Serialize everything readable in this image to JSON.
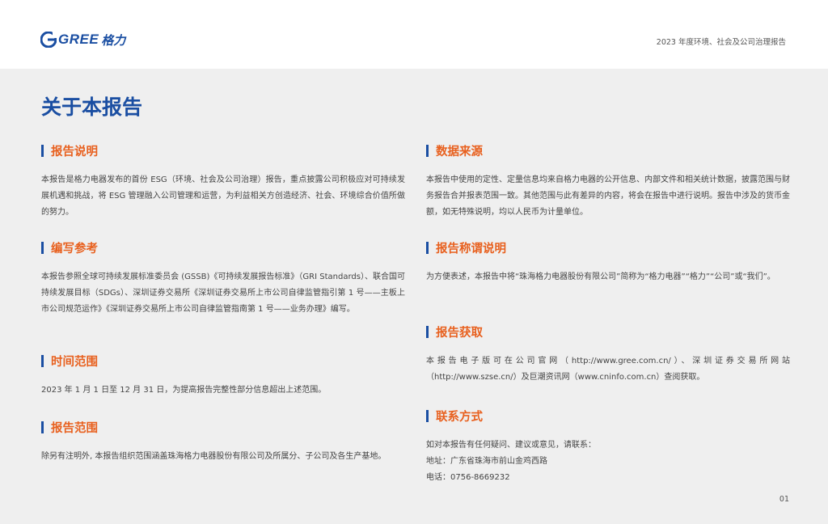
{
  "header": {
    "logo_text": "GREE",
    "logo_cn": "格力",
    "report_title": "2023 年度环境、社会及公司治理报告"
  },
  "page_title": "关于本报告",
  "sections": {
    "report_desc": {
      "title": "报告说明",
      "body": "本报告是格力电器发布的首份 ESG（环境、社会及公司治理）报告，重点披露公司积极应对可持续发展机遇和挑战，将 ESG 管理融入公司管理和运营，为利益相关方创造经济、社会、环境综合价值所做的努力。"
    },
    "reference": {
      "title": "编写参考",
      "body": "本报告参照全球可持续发展标准委员会 (GSSB)《可持续发展报告标准》（GRI Standards）、联合国可持续发展目标（SDGs）、深圳证券交易所《深圳证券交易所上市公司自律监管指引第 1 号——主板上市公司规范运作》《深圳证券交易所上市公司自律监管指南第 1 号——业务办理》编写。"
    },
    "time_range": {
      "title": "时间范围",
      "body": "2023 年 1 月 1 日至 12 月 31 日，为提高报告完整性部分信息超出上述范围。"
    },
    "scope": {
      "title": "报告范围",
      "body": "除另有注明外, 本报告组织范围涵盖珠海格力电器股份有限公司及所属分、子公司及各生产基地。"
    },
    "data_source": {
      "title": "数据来源",
      "body": "本报告中使用的定性、定量信息均来自格力电器的公开信息、内部文件和相关统计数据，披露范围与财务报告合并报表范围一致。其他范围与此有差异的内容，将会在报告中进行说明。报告中涉及的货币金额，如无特殊说明，均以人民币为计量单位。"
    },
    "naming": {
      "title": "报告称谓说明",
      "body": "为方便表述，本报告中将“珠海格力电器股份有限公司”简称为“格力电器”“格力”“公司”或“我们”。"
    },
    "access": {
      "title": "报告获取",
      "body": "本报告电子版可在公司官网（http://www.gree.com.cn/）、深圳证券交易所网站（http://www.szse.cn/）及巨潮资讯网（www.cninfo.com.cn）查阅获取。"
    },
    "contact": {
      "title": "联系方式",
      "intro": "如对本报告有任何疑问、建议或意见，请联系：",
      "address": "地址：广东省珠海市前山金鸡西路",
      "phone": "电话：0756-8669232"
    }
  },
  "page_number": "01",
  "colors": {
    "brand_blue": "#1a4ea2",
    "heading_orange": "#e8601e"
  }
}
